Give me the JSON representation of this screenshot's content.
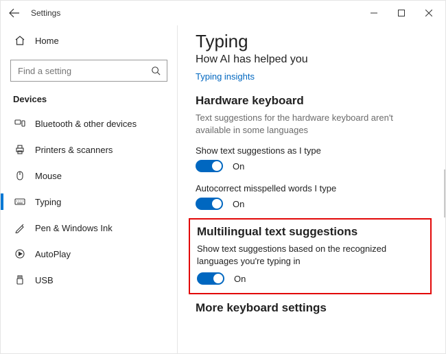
{
  "window": {
    "title": "Settings"
  },
  "sidebar": {
    "home": "Home",
    "search_placeholder": "Find a setting",
    "category": "Devices",
    "items": [
      {
        "label": "Bluetooth & other devices"
      },
      {
        "label": "Printers & scanners"
      },
      {
        "label": "Mouse"
      },
      {
        "label": "Typing"
      },
      {
        "label": "Pen & Windows Ink"
      },
      {
        "label": "AutoPlay"
      },
      {
        "label": "USB"
      }
    ]
  },
  "main": {
    "title": "Typing",
    "subtitle": "How AI has helped you",
    "link": "Typing insights",
    "hw_heading": "Hardware keyboard",
    "hw_note": "Text suggestions for the hardware keyboard aren't available in some languages",
    "setting1_label": "Show text suggestions as I type",
    "setting1_state": "On",
    "setting2_label": "Autocorrect misspelled words I type",
    "setting2_state": "On",
    "ml_heading": "Multilingual text suggestions",
    "ml_note": "Show text suggestions based on the recognized languages you're typing in",
    "ml_state": "On",
    "more_heading": "More keyboard settings"
  }
}
